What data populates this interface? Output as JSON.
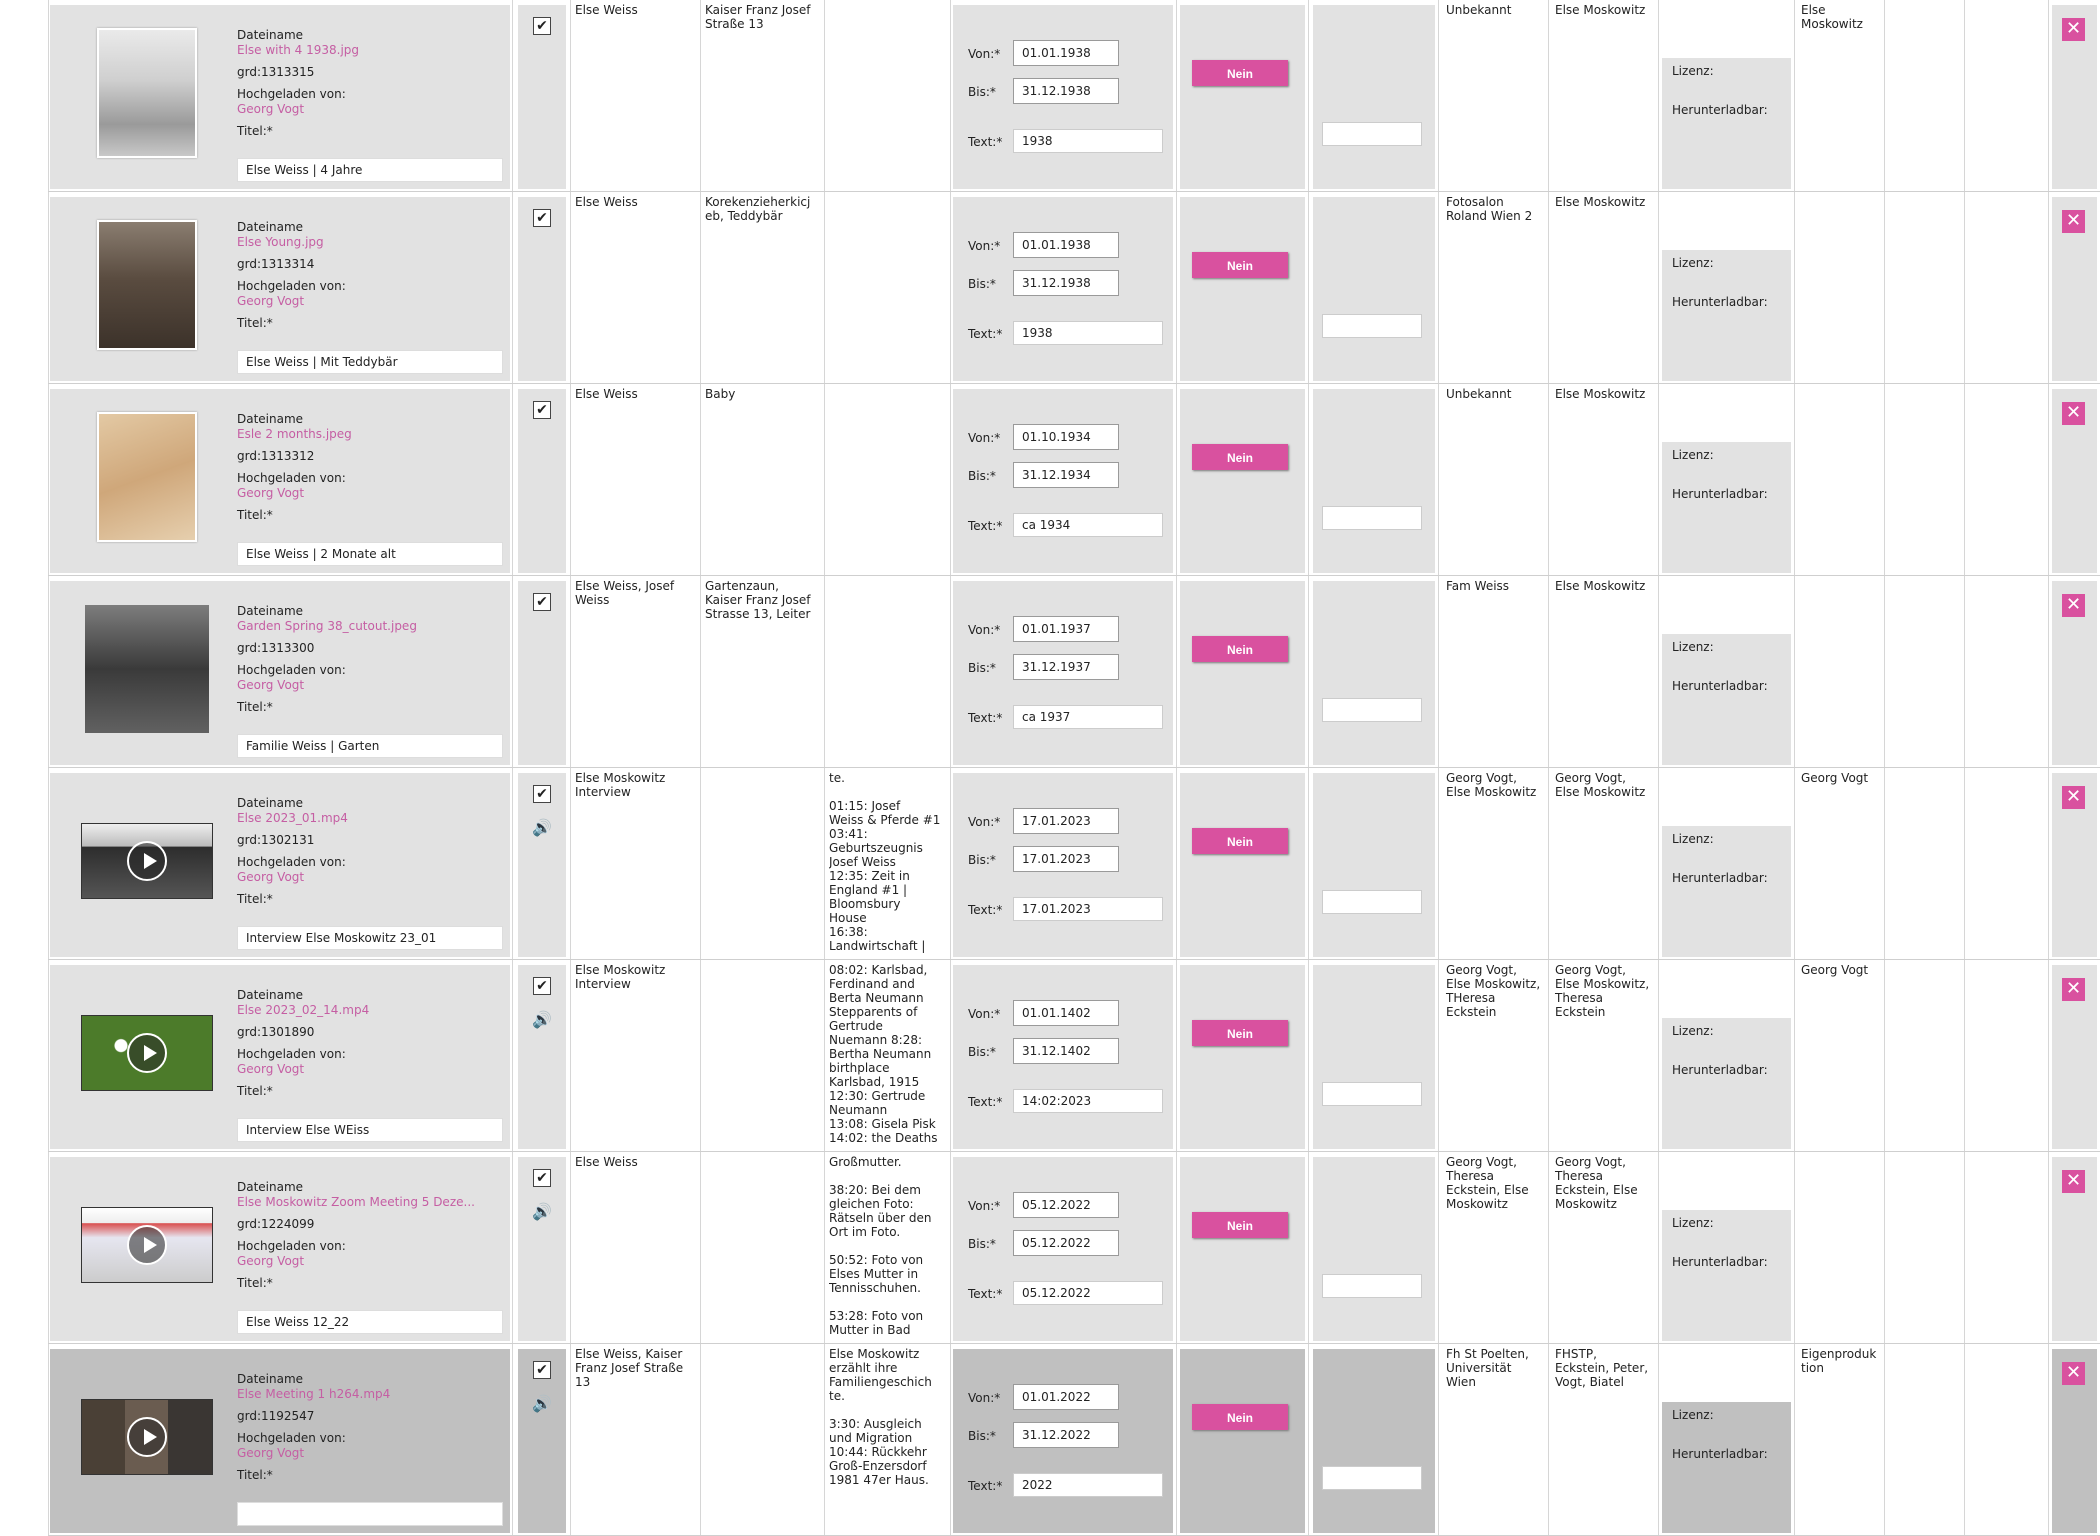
{
  "labels": {
    "dateiname": "Dateiname",
    "hochgeladen": "Hochgeladen von:",
    "titel": "Titel:*",
    "von": "Von:*",
    "bis": "Bis:*",
    "text": "Text:*",
    "nein": "Nein",
    "lizenz": "Lizenz:",
    "herunterladbar": "Herunterladbar:"
  },
  "icons": {
    "checkbox": "check-icon",
    "speaker": "speaker-icon",
    "play": "play-icon",
    "delete": "close-icon"
  },
  "colors": {
    "accent": "#d9519f",
    "link": "#c55ea3",
    "cell_bg": "#e2e2e2",
    "selected_bg": "#c0c0c0"
  },
  "rows": [
    {
      "filename": "Else with 4 1938.jpg",
      "grd": "grd:1313315",
      "uploader": "Georg Vogt",
      "title": "Else Weiss | 4 Jahre",
      "media": "photo",
      "checked": "✔",
      "audio": false,
      "persons": "Else Weiss",
      "place": "Kaiser Franz Josef\nStraße 13",
      "description": "",
      "von": "01.01.1938",
      "bis": "31.12.1938",
      "text": "1938",
      "photographer": "Unbekannt",
      "owner": "Else Moskowitz",
      "rights": "Else\nMoskowitz"
    },
    {
      "filename": "Else Young.jpg",
      "grd": "grd:1313314",
      "uploader": "Georg Vogt",
      "title": "Else Weiss | Mit Teddybär",
      "media": "photo",
      "checked": "✔",
      "audio": false,
      "persons": "Else Weiss",
      "place": "Korekenzieherkicj\neb, Teddybär",
      "description": "",
      "von": "01.01.1938",
      "bis": "31.12.1938",
      "text": "1938",
      "photographer": "Fotosalon\nRoland Wien 2",
      "owner": "Else Moskowitz",
      "rights": ""
    },
    {
      "filename": "Esle 2 months.jpeg",
      "grd": "grd:1313312",
      "uploader": "Georg Vogt",
      "title": "Else Weiss | 2 Monate alt",
      "media": "photo",
      "checked": "✔",
      "audio": false,
      "persons": "Else Weiss",
      "place": "Baby",
      "description": "",
      "von": "01.10.1934",
      "bis": "31.12.1934",
      "text": "ca 1934",
      "photographer": "Unbekannt",
      "owner": "Else Moskowitz",
      "rights": ""
    },
    {
      "filename": "Garden Spring 38_cutout.jpeg",
      "grd": "grd:1313300",
      "uploader": "Georg Vogt",
      "title": "Familie Weiss | Garten",
      "media": "photo",
      "checked": "✔",
      "audio": false,
      "persons": "Else Weiss, Josef\nWeiss",
      "place": "Gartenzaun,\nKaiser Franz Josef\nStrasse 13, Leiter",
      "description": "",
      "von": "01.01.1937",
      "bis": "31.12.1937",
      "text": "ca 1937",
      "photographer": "Fam Weiss",
      "owner": "Else Moskowitz",
      "rights": ""
    },
    {
      "filename": "Else 2023_01.mp4",
      "grd": "grd:1302131",
      "uploader": "Georg Vogt",
      "title": "Interview Else Moskowitz 23_01",
      "media": "video",
      "checked": "✔",
      "audio": true,
      "persons": "Else Moskowitz\nInterview",
      "place": "",
      "description": "te.\n\n01:15: Josef\nWeiss & Pferde #1\n03:41:\nGeburtszeugnis\nJosef Weiss\n12:35: Zeit in\nEngland #1 |\nBloomsbury\nHouse\n16:38:\nLandwirtschaft |",
      "von": "17.01.2023",
      "bis": "17.01.2023",
      "text": "17.01.2023",
      "photographer": "Georg Vogt,\nElse Moskowitz",
      "owner": "Georg Vogt,\nElse Moskowitz",
      "rights": "Georg Vogt"
    },
    {
      "filename": "Else 2023_02_14.mp4",
      "grd": "grd:1301890",
      "uploader": "Georg Vogt",
      "title": "Interview Else WEiss",
      "media": "video",
      "checked": "✔",
      "audio": true,
      "persons": "Else Moskowitz\nInterview",
      "place": "",
      "description": "08:02: Karlsbad,\nFerdinand and\nBerta Neumann\nStepparents of\nGertrude\nNuemann 8:28:\nBertha Neumann\nbirthplace\nKarlsbad, 1915\n12:30: Gertrude\nNeumann\n13:08: Gisela Pisk\n14:02: the Deaths",
      "von": "01.01.1402",
      "bis": "31.12.1402",
      "text": "14:02:2023",
      "photographer": "Georg Vogt,\nElse Moskowitz,\nTHeresa\nEckstein",
      "owner": "Georg Vogt,\nElse Moskowitz,\nTheresa\nEckstein",
      "rights": "Georg Vogt"
    },
    {
      "filename": "Else Moskowitz Zoom Meeting 5 Deze...",
      "grd": "grd:1224099",
      "uploader": "Georg Vogt",
      "title": "Else Weiss 12_22",
      "media": "video",
      "checked": "✔",
      "audio": true,
      "persons": "Else Weiss",
      "place": "",
      "description": "Großmutter.\n\n38:20: Bei dem\ngleichen Foto:\nRätseln über den\nOrt im Foto.\n\n50:52: Foto von\nElses Mutter in\nTennisschuhen.\n\n53:28: Foto von\nMutter in Bad",
      "von": "05.12.2022",
      "bis": "05.12.2022",
      "text": "05.12.2022",
      "photographer": "Georg Vogt,\nTheresa\nEckstein, Else\nMoskowitz",
      "owner": "Georg Vogt,\nTheresa\nEckstein, Else\nMoskowitz",
      "rights": ""
    },
    {
      "filename": "Else Meeting 1 h264.mp4",
      "grd": "grd:1192547",
      "uploader": "Georg Vogt",
      "title": "",
      "media": "video",
      "checked": "✔",
      "audio": true,
      "persons": "Else Weiss, Kaiser\nFranz Josef Straße\n13",
      "place": "",
      "description": "Else Moskowitz\nerzählt ihre\nFamiliengeschich\nte.\n\n3:30: Ausgleich\nund Migration\n10:44: Rückkehr\nGroß-Enzersdorf\n1981 47er Haus.",
      "von": "01.01.2022",
      "bis": "31.12.2022",
      "text": "2022",
      "photographer": "Fh St Poelten,\nUniversität\nWien",
      "owner": "FHSTP,\nEckstein, Peter,\nVogt, Biatel",
      "rights": "Eigenproduk\ntion"
    }
  ]
}
